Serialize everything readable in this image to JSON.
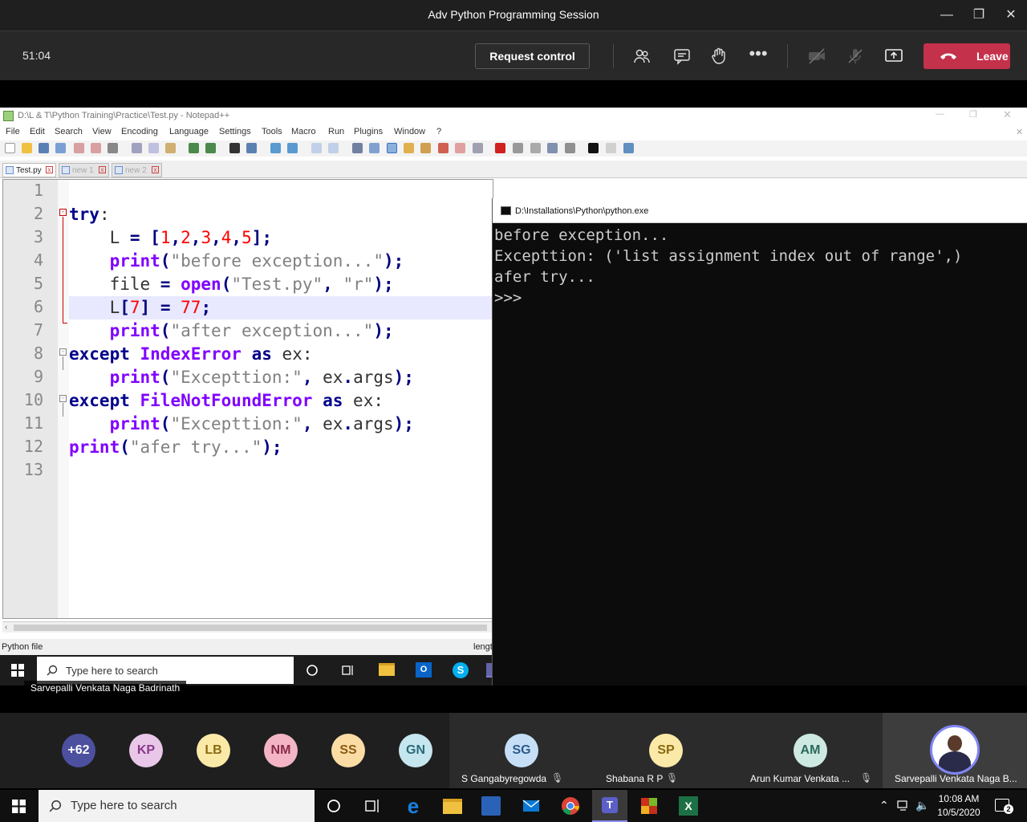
{
  "teams": {
    "title": "Adv Python Programming Session",
    "timer": "51:04",
    "request_control": "Request control",
    "leave": "Leave"
  },
  "notepad": {
    "title": "D:\\L & T\\Python Training\\Practice\\Test.py - Notepad++",
    "menu": [
      "File",
      "Edit",
      "Search",
      "View",
      "Encoding",
      "Language",
      "Settings",
      "Tools",
      "Macro",
      "Run",
      "Plugins",
      "Window",
      "?"
    ],
    "tabs": [
      "Test.py",
      "new 1",
      "new 2"
    ],
    "line_numbers": [
      "1",
      "2",
      "3",
      "4",
      "5",
      "6",
      "7",
      "8",
      "9",
      "10",
      "11",
      "12",
      "13"
    ],
    "status_left": "Python file",
    "status_right": "lengt"
  },
  "console": {
    "title": "D:\\Installations\\Python\\python.exe",
    "lines": [
      "before exception...",
      "Excepttion: ('list assignment index out of range',)",
      "afer try...",
      ">>>"
    ]
  },
  "shared_taskbar": {
    "search_placeholder": "Type here to search",
    "presenter_name": "Sarvepalli Venkata Naga Badrinath"
  },
  "participants": {
    "overflow": "+62",
    "avatars": [
      {
        "initials": "KP",
        "color": "#e8c7e8"
      },
      {
        "initials": "LB",
        "color": "#fbe9a8"
      },
      {
        "initials": "NM",
        "color": "#f3b5c6"
      },
      {
        "initials": "SS",
        "color": "#fbdca5"
      },
      {
        "initials": "GN",
        "color": "#c6e6ef"
      }
    ],
    "tiles": [
      {
        "initials": "SG",
        "name": "S Gangabyregowda",
        "color": "#c6dff7"
      },
      {
        "initials": "SP",
        "name": "Shabana R P",
        "color": "#fbe9a8"
      },
      {
        "initials": "AM",
        "name": "Arun Kumar Venkata ...",
        "color": "#cde9e2"
      },
      {
        "initials": "",
        "name": "Sarvepalli Venkata Naga B..."
      }
    ]
  },
  "taskbar": {
    "search_placeholder": "Type here to search",
    "time": "10:08 AM",
    "date": "10/5/2020",
    "notifications": "2"
  }
}
